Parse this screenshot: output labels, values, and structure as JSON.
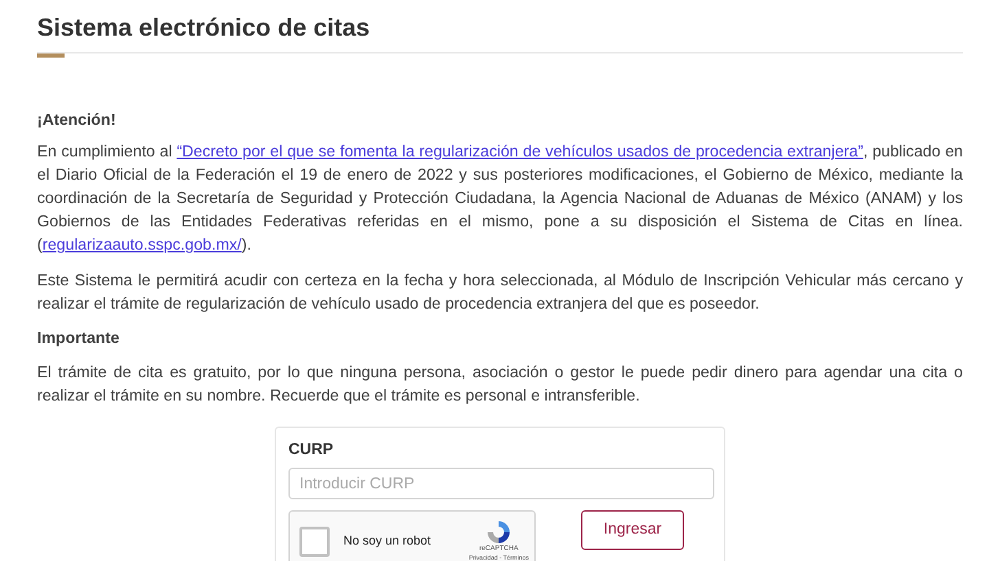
{
  "title": "Sistema electrónico de citas",
  "notice": {
    "heading": "¡Atención!",
    "paragraph": [
      {
        "kind": "text",
        "text": "En cumplimiento al "
      },
      {
        "kind": "link",
        "text": "“Decreto por el que se fomenta la regularización de vehículos usados de procedencia extranjera”"
      },
      {
        "kind": "text",
        "text": ", publicado en el Diario Oficial de la Federación el 19 de enero de 2022 y sus posteriores modificaciones, el Gobierno de México, mediante la coordinación de la Secretaría de Seguridad y Protección Ciudadana, la Agencia Nacional de Aduanas de México (ANAM) y los Gobiernos de las Entidades Federativas referidas en el mismo, pone a su disposición el Sistema de Citas en línea. ("
      },
      {
        "kind": "link",
        "text": "regularizaauto.sspc.gob.mx/"
      },
      {
        "kind": "text",
        "text": ")."
      }
    ],
    "second": "Este Sistema le permitirá acudir con certeza en la fecha y hora seleccionada, al Módulo de Inscripción Vehicular más cercano y realizar el trámite de regularización de vehículo usado de procedencia extranjera del que es poseedor."
  },
  "important": {
    "heading": "Importante",
    "text": "El trámite de cita es gratuito, por lo que ninguna persona, asociación o gestor le puede pedir dinero para agendar una cita o realizar el trámite en su nombre. Recuerde que el trámite es personal e intransferible."
  },
  "form": {
    "label": "CURP",
    "placeholder": "Introducir CURP",
    "captcha": {
      "label": "No soy un robot",
      "checked": false,
      "brand": "reCAPTCHA",
      "links": "Privacidad - Términos"
    },
    "button": "Ingresar"
  }
}
